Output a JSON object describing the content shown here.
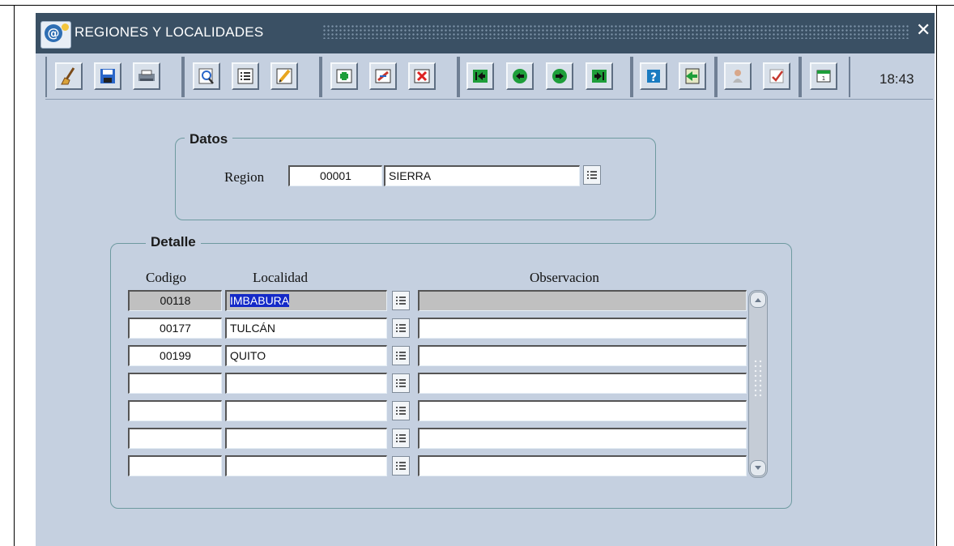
{
  "window": {
    "title": "REGIONES Y LOCALIDADES",
    "icon": "address-book-icon",
    "close_glyph": "✕"
  },
  "toolbar": {
    "groups": [
      [
        "clear-form-icon",
        "save-icon",
        "print-icon"
      ],
      [
        "query-icon",
        "list-icon",
        "edit-icon"
      ],
      [
        "insert-record-icon",
        "duplicate-record-icon",
        "delete-record-icon"
      ],
      [
        "first-record-icon",
        "previous-record-icon",
        "next-record-icon",
        "last-record-icon"
      ],
      [
        "help-icon",
        "exit-icon"
      ],
      [
        "user-icon",
        "check-icon"
      ],
      [
        "calendar-icon"
      ]
    ],
    "clock": "18:43"
  },
  "datos": {
    "title": "Datos",
    "region_label": "Region",
    "region_code": "00001",
    "region_name": "SIERRA"
  },
  "detalle": {
    "title": "Detalle",
    "columns": [
      "Codigo",
      "Localidad",
      "Observacion"
    ],
    "rows": [
      {
        "codigo": "00118",
        "localidad": "IMBABURA",
        "observacion": ""
      },
      {
        "codigo": "00177",
        "localidad": "TULCÁN",
        "observacion": ""
      },
      {
        "codigo": "00199",
        "localidad": "QUITO",
        "observacion": ""
      },
      {
        "codigo": "",
        "localidad": "",
        "observacion": ""
      },
      {
        "codigo": "",
        "localidad": "",
        "observacion": ""
      },
      {
        "codigo": "",
        "localidad": "",
        "observacion": ""
      },
      {
        "codigo": "",
        "localidad": "",
        "observacion": ""
      }
    ]
  },
  "colors": {
    "titlebar": "#3a5064",
    "canvas": "#c5d0e0",
    "selection": "#1429c8",
    "current_row": "#c0c0c0"
  }
}
